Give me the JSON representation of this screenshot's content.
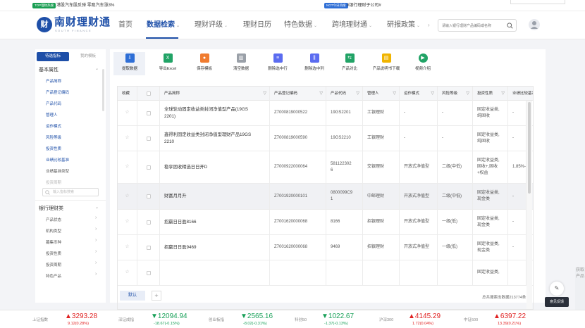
{
  "ticker": {
    "tag1": "TOP理财热搜",
    "text1": "港股汽车股反弹 零跑汽车涨3%",
    "tag2": "NOT今日热搜",
    "text2": "#银行理财子公司#"
  },
  "header": {
    "logo_mark": "财",
    "logo_text": "南财理财通",
    "logo_sub": "SOUTH FINANCE",
    "nav": [
      {
        "label": "首页"
      },
      {
        "label": "数据检索"
      },
      {
        "label": "理财评级"
      },
      {
        "label": "理财日历"
      },
      {
        "label": "特色数据"
      },
      {
        "label": "跨境理财通"
      },
      {
        "label": "研报政策"
      }
    ],
    "search_placeholder": "请输入银行理财产品编码或名称"
  },
  "left_panel": {
    "tabs": [
      "待选指标",
      "我的模板"
    ],
    "basic_section": "基本属性",
    "basic_items": [
      "产品简称",
      "产品登记编码",
      "产品代码",
      "管理人",
      "运作模式",
      "风险等级",
      "投资性质",
      "业绩比较基准",
      "业绩基准类型",
      "投资周期"
    ],
    "search_placeholder": "输入指标搜索",
    "bank_section": "银行理财类",
    "bank_items": [
      "产品状态",
      "机构类型",
      "募集币种",
      "投资性质",
      "投资周期",
      "特色产品"
    ]
  },
  "toolbar": [
    {
      "label": "提取数据",
      "icon": "extract-icon",
      "color": "#2f6fd6"
    },
    {
      "label": "导出Excel",
      "icon": "excel-icon",
      "color": "#21a366"
    },
    {
      "label": "保存模板",
      "icon": "save-template-icon",
      "color": "#f07c30"
    },
    {
      "label": "清空数据",
      "icon": "trash-icon",
      "color": "#9aa0a8"
    },
    {
      "label": "删除选中行",
      "icon": "delete-row-icon",
      "color": "#5b6cf0"
    },
    {
      "label": "删除选中列",
      "icon": "delete-col-icon",
      "color": "#5b6cf0"
    },
    {
      "label": "产品对比",
      "icon": "compare-icon",
      "color": "#21a366"
    },
    {
      "label": "产品说明书下载",
      "icon": "download-icon",
      "color": "#f0b400"
    },
    {
      "label": "视频介绍",
      "icon": "play-icon",
      "color": "#21a366"
    }
  ],
  "table": {
    "headers": [
      "收藏",
      "",
      "产品简称",
      "产品登记编码",
      "产品代码",
      "管理人",
      "运作模式",
      "风险等级",
      "投资性质",
      "业绩比较基准"
    ],
    "rows": [
      {
        "name": [
          "全球轮动固定收益类封闭净值型产品(19GS",
          "2201)"
        ],
        "reg": "Z7000819000522",
        "code": [
          "19GS2201"
        ],
        "mgr": "工银理财",
        "mode": "-",
        "risk": "-",
        "nature": [
          "固定收益类,",
          "纯固收"
        ],
        "bench": "-"
      },
      {
        "name": [
          "鑫得利固定收益类封闭净值型理财产品19GS",
          "2210"
        ],
        "reg": "Z7000819000590",
        "code": [
          "19GS2210"
        ],
        "mgr": "工银理财",
        "mode": "-",
        "risk": "-",
        "nature": [
          "固定收益类,",
          "纯固收"
        ],
        "bench": "-"
      },
      {
        "name": [
          "稳享固收精选日日开D"
        ],
        "reg": "Z7000922000064",
        "code": [
          "581122302",
          "6"
        ],
        "mgr": "交银理财",
        "mode": "开放式净值型",
        "risk": "二级(中低)",
        "nature": [
          "固定收益类,",
          "固收+,固收",
          "+权益"
        ],
        "bench": "1.85%-2"
      },
      {
        "name": [
          "财富月月升"
        ],
        "reg": "Z7001920000101",
        "code": [
          "0800099C9",
          "1"
        ],
        "mgr": "中邮理财",
        "mode": "开放式净值型",
        "risk": "二级(中低)",
        "nature": [
          "固定收益类,",
          "现金类"
        ],
        "bench": "-"
      },
      {
        "name": [
          "招赢日日盈8166"
        ],
        "reg": "Z7001620000068",
        "code": [
          "8166"
        ],
        "mgr": "招银理财",
        "mode": "开放式净值型",
        "risk": "一级(低)",
        "nature": [
          "固定收益类,",
          "现金类"
        ],
        "bench": "-"
      },
      {
        "name": [
          "招赢日日盈9469"
        ],
        "reg": "Z7001620000068",
        "code": [
          "9469"
        ],
        "mgr": "招银理财",
        "mode": "开放式净值型",
        "risk": "一级(低)",
        "nature": [
          "固定收益类,",
          "现金类"
        ],
        "bench": "-"
      },
      {
        "name": [
          ""
        ],
        "reg": "",
        "code": [
          ""
        ],
        "mgr": "",
        "mode": "",
        "risk": "",
        "nature": [
          "固定收益类,"
        ],
        "bench": ""
      }
    ]
  },
  "footer": {
    "tab": "默认",
    "add": "+",
    "total": "总共搜索出数据213774条"
  },
  "floats": {
    "feedback": "意见反馈",
    "strip": "获取产品"
  },
  "indices": [
    {
      "name": "上证指数",
      "value": "3293.28",
      "dir": "up",
      "change": "9.12(0.28%)"
    },
    {
      "name": "深证成指",
      "value": "12094.94",
      "dir": "dn",
      "change": "-18.67(-0.15%)"
    },
    {
      "name": "创业板指",
      "value": "2565.16",
      "dir": "dn",
      "change": "-8.02(-0.31%)"
    },
    {
      "name": "科创50",
      "value": "1022.67",
      "dir": "dn",
      "change": "-1.37(-0.13%)"
    },
    {
      "name": "沪深300",
      "value": "4145.29",
      "dir": "up",
      "change": "1.72(0.04%)"
    },
    {
      "name": "中证500",
      "value": "6397.22",
      "dir": "up",
      "change": "13.39(0.21%)"
    }
  ]
}
